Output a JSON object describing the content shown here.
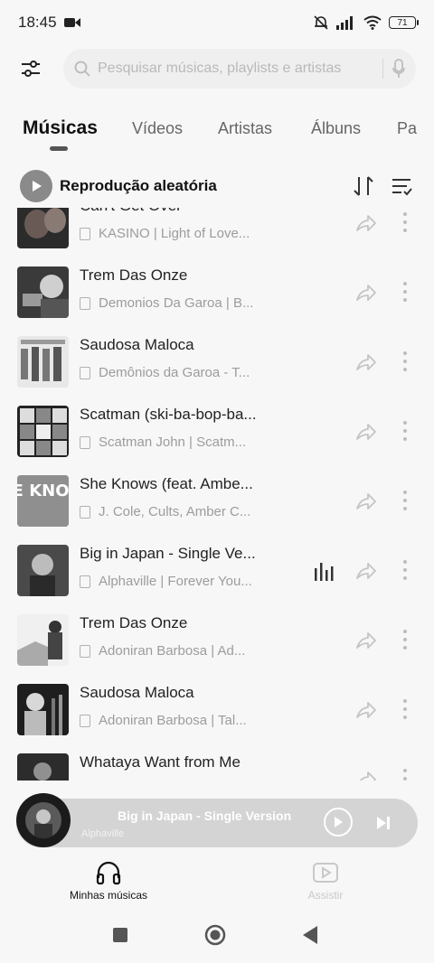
{
  "status_bar": {
    "time": "18:45",
    "battery": "71"
  },
  "search": {
    "placeholder": "Pesquisar músicas, playlists e artistas"
  },
  "tabs": [
    {
      "label": "Músicas",
      "active": true
    },
    {
      "label": "Vídeos",
      "active": false
    },
    {
      "label": "Artistas",
      "active": false
    },
    {
      "label": "Álbuns",
      "active": false
    },
    {
      "label": "Pa",
      "active": false
    }
  ],
  "shuffle": {
    "label": "Reprodução aleatória"
  },
  "songs": [
    {
      "title": "Can't Get Over",
      "subtitle": "KASINO | Light of Love..."
    },
    {
      "title": "Trem Das Onze",
      "subtitle": "Demonios Da Garoa | B..."
    },
    {
      "title": "Saudosa Maloca",
      "subtitle": "Demônios da Garoa - T..."
    },
    {
      "title": "Scatman (ski-ba-bop-ba...",
      "subtitle": "Scatman John | Scatm..."
    },
    {
      "title": "She Knows (feat. Ambe...",
      "subtitle": "J. Cole, Cults, Amber C...",
      "cover_text": "SHE KNOWS"
    },
    {
      "title": "Big in Japan - Single Ve...",
      "subtitle": "Alphaville | Forever You...",
      "playing": true
    },
    {
      "title": "Trem Das Onze",
      "subtitle": "Adoniran Barbosa | Ad..."
    },
    {
      "title": "Saudosa Maloca",
      "subtitle": "Adoniran Barbosa | Tal..."
    },
    {
      "title": "Whataya Want from Me",
      "subtitle": ""
    }
  ],
  "mini_player": {
    "title": "Big in Japan - Single Version",
    "artist": "Alphaville"
  },
  "bottom_nav": [
    {
      "label": "Minhas músicas",
      "active": true
    },
    {
      "label": "Assistir",
      "active": false
    }
  ]
}
